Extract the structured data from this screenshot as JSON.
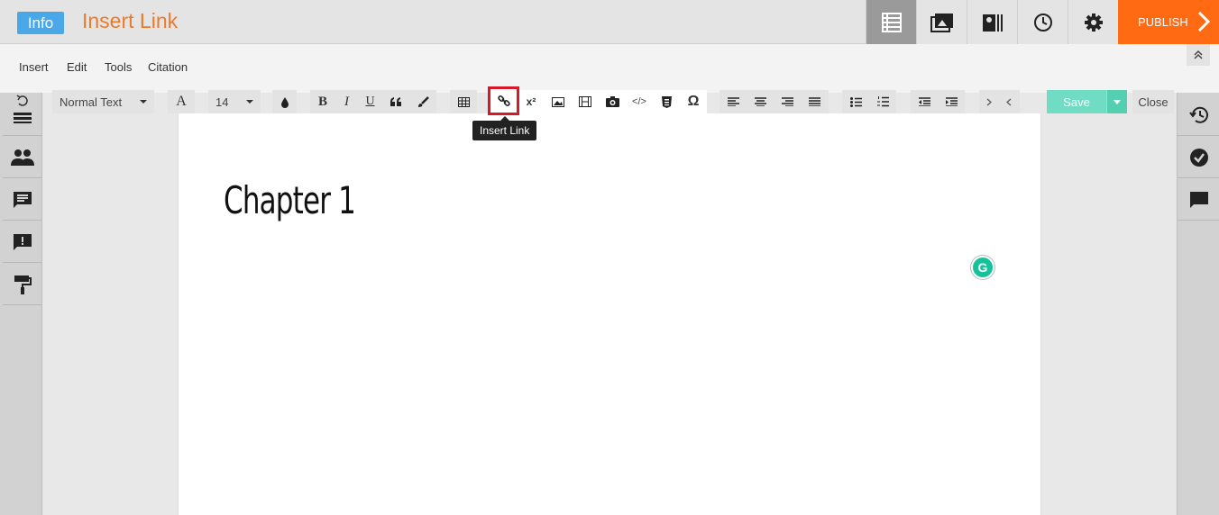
{
  "header": {
    "info_label": "Info",
    "title": "Insert Link",
    "publish_label": "PUBLISH"
  },
  "menu": {
    "items": [
      "Insert",
      "Edit",
      "Tools",
      "Citation"
    ]
  },
  "toolbar": {
    "paragraph_style": "Normal Text",
    "font_size": "14",
    "bold": "B",
    "italic": "I",
    "underline": "U",
    "superscript": "x²",
    "omega": "Ω",
    "tooltip": "Insert Link",
    "save_label": "Save",
    "close_label": "Close"
  },
  "document": {
    "heading": "Chapter 1"
  },
  "colors": {
    "accent_orange": "#ff6a13",
    "title_orange": "#ec7a2b",
    "info_blue": "#4aa8e8",
    "save_green": "#6fdcc3",
    "highlight_red": "#d7182a"
  }
}
